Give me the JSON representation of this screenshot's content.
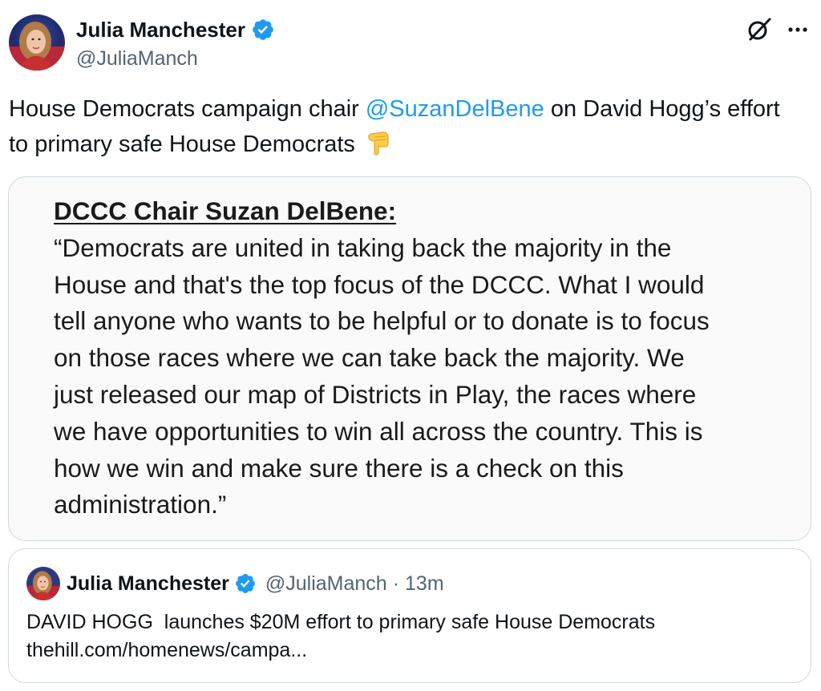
{
  "author": {
    "display_name": "Julia Manchester",
    "handle": "@JuliaManch",
    "verified": true,
    "avatar_icon": "profile-photo",
    "verified_icon": "verified-badge-icon"
  },
  "header_actions": {
    "grok_icon": "grok-icon",
    "more_icon": "more-options-icon"
  },
  "tweet": {
    "text_before_mention": "House Democrats campaign chair ",
    "mention": "@SuzanDelBene",
    "text_after_mention": " on David Hogg’s effort to primary safe House Democrats",
    "emoji": "👇",
    "emoji_icon": "backhand-index-pointing-down-icon"
  },
  "media": {
    "heading": "DCCC Chair Suzan DelBene:",
    "lines": [
      "“Democrats are united in taking back the majority in the",
      "House and that's the top focus of the DCCC. What I would",
      "tell anyone who wants to be helpful or to donate is to focus",
      "on those races where we can take back the majority. We",
      "just released our map of Districts in Play, the races where",
      "we have opportunities to win all across the country. This is",
      "how we win and make sure there is a check on this",
      "administration.”"
    ]
  },
  "quote": {
    "display_name": "Julia Manchester",
    "handle": "@JuliaManch",
    "separator": "·",
    "time": "13m",
    "text": "DAVID HOGG  launches $20M effort to primary safe House Democrats",
    "link": "thehill.com/homenews/campa..."
  },
  "colors": {
    "text_primary": "#0f1419",
    "text_secondary": "#536471",
    "link_blue": "#1d9bf0",
    "border": "#cfd9de",
    "verified_blue": "#1d9bf0"
  }
}
